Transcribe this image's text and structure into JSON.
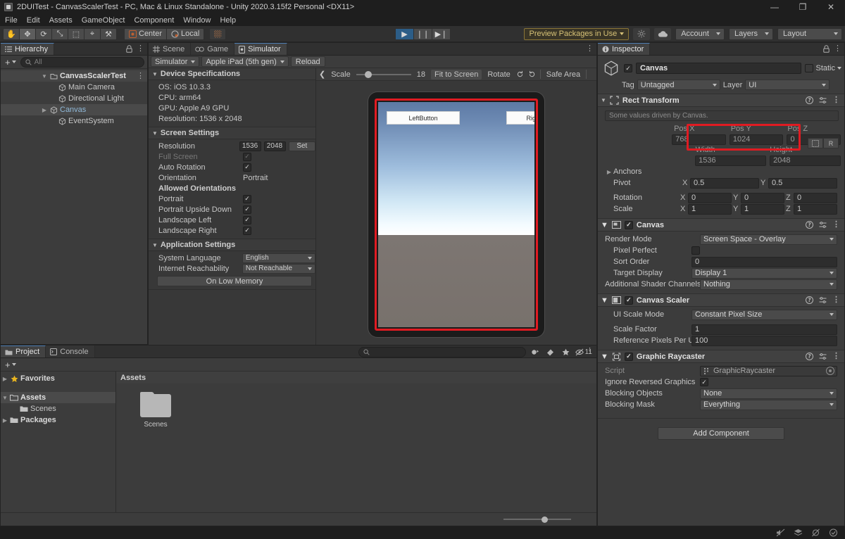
{
  "window": {
    "title": "2DUITest - CanvasScalerTest - PC, Mac & Linux Standalone - Unity 2020.3.15f2 Personal <DX11>",
    "app_icon": "unity-icon",
    "minimize": "—",
    "maximize": "❐",
    "close": "✕"
  },
  "menubar": {
    "items": [
      "File",
      "Edit",
      "Assets",
      "GameObject",
      "Component",
      "Window",
      "Help"
    ]
  },
  "toolbar": {
    "tools": [
      {
        "name": "hand-tool",
        "glyph": "✋"
      },
      {
        "name": "move-tool",
        "glyph": "✥"
      },
      {
        "name": "rotate-tool",
        "glyph": "⟳"
      },
      {
        "name": "scale-tool",
        "glyph": "⤡"
      },
      {
        "name": "rect-tool",
        "glyph": "⬚"
      },
      {
        "name": "transform-tool",
        "glyph": "⌖"
      },
      {
        "name": "custom-tool",
        "glyph": "⚒"
      }
    ],
    "pivot_label": "Center",
    "pivot_icon": "pivot-center-icon",
    "space_label": "Local",
    "space_icon": "handle-local-icon",
    "grid_icon": "grid-snapping-icon",
    "play_label": "▶",
    "pause_label": "❘❘",
    "step_label": "▶❘",
    "preview_packages": "Preview Packages in Use",
    "collab_icon": "collab-icon",
    "cloud_icon": "cloud-icon",
    "account_label": "Account",
    "layers_label": "Layers",
    "layout_label": "Layout"
  },
  "hierarchy": {
    "tab_label": "Hierarchy",
    "tab_icon": "hierarchy-icon",
    "lock_icon": "lock-icon",
    "menu_icon": "kebab-icon",
    "add_label": "+",
    "search_placeholder": "All",
    "search_icon": "search-icon",
    "items": [
      {
        "label": "CanvasScalerTest",
        "depth": 0,
        "icon": "scene-icon",
        "expanded": true,
        "style": "root",
        "has_menu": true
      },
      {
        "label": "Main Camera",
        "depth": 1,
        "icon": "gameobject-icon",
        "expanded": null,
        "style": "normal",
        "has_menu": false
      },
      {
        "label": "Directional Light",
        "depth": 1,
        "icon": "gameobject-icon",
        "expanded": null,
        "style": "normal",
        "has_menu": false
      },
      {
        "label": "Canvas",
        "depth": 1,
        "icon": "gameobject-icon",
        "expanded": false,
        "style": "selected",
        "has_menu": false
      },
      {
        "label": "EventSystem",
        "depth": 1,
        "icon": "gameobject-icon",
        "expanded": null,
        "style": "normal",
        "has_menu": false
      }
    ]
  },
  "simulator": {
    "tabs": [
      {
        "label": "Scene",
        "icon": "scene-tab-icon",
        "active": false
      },
      {
        "label": "Game",
        "icon": "game-tab-icon",
        "active": false
      },
      {
        "label": "Simulator",
        "icon": "simulator-tab-icon",
        "active": true
      }
    ],
    "menu_icon": "kebab-icon",
    "mode_label": "Simulator",
    "device_label": "Apple iPad (5th gen)",
    "reload_label": "Reload",
    "device_specs": {
      "section_title": "Device Specifications",
      "lines": [
        "OS: iOS 10.3.3",
        "CPU: arm64",
        "GPU: Apple A9 GPU",
        "Resolution: 1536 x 2048"
      ]
    },
    "screen_settings": {
      "section_title": "Screen Settings",
      "resolution_label": "Resolution",
      "resolution_width": "1536",
      "resolution_height": "2048",
      "set_label": "Set",
      "full_screen_label": "Full Screen",
      "full_screen_checked": true,
      "auto_rotation_label": "Auto Rotation",
      "auto_rotation_checked": true,
      "orientation_label": "Orientation",
      "orientation_value": "Portrait",
      "allowed_orientations_label": "Allowed Orientations",
      "allowed": [
        {
          "label": "Portrait",
          "checked": true
        },
        {
          "label": "Portrait Upside Down",
          "checked": true
        },
        {
          "label": "Landscape Left",
          "checked": true
        },
        {
          "label": "Landscape Right",
          "checked": true
        }
      ]
    },
    "application_settings": {
      "section_title": "Application Settings",
      "system_language_label": "System Language",
      "system_language_value": "English",
      "internet_reachability_label": "Internet Reachability",
      "internet_reachability_value": "Not Reachable",
      "on_low_memory_label": "On Low Memory"
    },
    "view_toolbar": {
      "back_icon": "chevron-left-icon",
      "scale_label": "Scale",
      "scale_value": "18",
      "fit_label": "Fit to Screen",
      "rotate_label": "Rotate",
      "rotate_ccw_icon": "rotate-ccw-icon",
      "rotate_cw_icon": "rotate-cw-icon",
      "safe_area_label": "Safe Area"
    },
    "device_screen": {
      "left_button_label": "LeftButton",
      "right_button_label": "RightButton",
      "highlight_color": "#e01b22"
    }
  },
  "project": {
    "tabs": [
      {
        "label": "Project",
        "icon": "project-icon",
        "active": true
      },
      {
        "label": "Console",
        "icon": "console-icon",
        "active": false
      }
    ],
    "menu_icon": "kebab-icon",
    "add_label": "+",
    "search_placeholder": "",
    "search_icon": "search-icon",
    "filter_icons": [
      "object-filter-icon",
      "label-filter-icon",
      "favorite-filter-icon",
      "hidden-packages-icon"
    ],
    "hidden_packages_count": "11",
    "tree": [
      {
        "label": "Favorites",
        "depth": 0,
        "icon": "star-icon",
        "expanded": false,
        "style": "bold"
      },
      {
        "label": "Assets",
        "depth": 0,
        "icon": "folder-open-icon",
        "expanded": true,
        "style": "selected-bold"
      },
      {
        "label": "Scenes",
        "depth": 1,
        "icon": "folder-icon",
        "expanded": null,
        "style": "normal"
      },
      {
        "label": "Packages",
        "depth": 0,
        "icon": "folder-icon",
        "expanded": false,
        "style": "bold"
      }
    ],
    "content_header": "Assets",
    "assets": [
      {
        "label": "Scenes",
        "icon": "folder-icon"
      }
    ]
  },
  "inspector": {
    "tab_label": "Inspector",
    "tab_icon": "inspector-icon",
    "lock_icon": "lock-icon",
    "menu_icon": "kebab-icon",
    "object": {
      "enabled": true,
      "name": "Canvas",
      "icon": "gameobject-icon",
      "static_label": "Static",
      "static_checked": false,
      "tag_label": "Tag",
      "tag_value": "Untagged",
      "layer_label": "Layer",
      "layer_value": "UI"
    },
    "rect_transform": {
      "title": "Rect Transform",
      "icon": "rect-transform-icon",
      "help_icon": "help-icon",
      "preset_icon": "preset-icon",
      "menu_icon": "kebab-icon",
      "driven_note": "Some values driven by Canvas.",
      "pos_headers": [
        "Pos X",
        "Pos Y",
        "Pos Z"
      ],
      "pos_values": [
        "768",
        "1024",
        "0"
      ],
      "size_headers": [
        "Width",
        "Height"
      ],
      "size_values": [
        "1536",
        "2048"
      ],
      "anchors_label": "Anchors",
      "pivot_label": "Pivot",
      "pivot_values": [
        "0.5",
        "0.5"
      ],
      "rotation_label": "Rotation",
      "rotation_values": [
        "0",
        "0",
        "0"
      ],
      "scale_label": "Scale",
      "scale_values": [
        "1",
        "1",
        "1"
      ],
      "blueprint_icon": "blueprint-mode-icon",
      "raw_label": "R",
      "highlight_color": "#e01b22"
    },
    "canvas": {
      "title": "Canvas",
      "icon": "canvas-icon",
      "enabled": true,
      "help_icon": "help-icon",
      "preset_icon": "preset-icon",
      "menu_icon": "kebab-icon",
      "render_mode_label": "Render Mode",
      "render_mode_value": "Screen Space - Overlay",
      "pixel_perfect_label": "Pixel Perfect",
      "pixel_perfect_checked": false,
      "sort_order_label": "Sort Order",
      "sort_order_value": "0",
      "target_display_label": "Target Display",
      "target_display_value": "Display 1",
      "shader_channels_label": "Additional Shader Channels",
      "shader_channels_value": "Nothing"
    },
    "canvas_scaler": {
      "title": "Canvas Scaler",
      "icon": "canvas-scaler-icon",
      "enabled": true,
      "help_icon": "help-icon",
      "preset_icon": "preset-icon",
      "menu_icon": "kebab-icon",
      "ui_scale_mode_label": "UI Scale Mode",
      "ui_scale_mode_value": "Constant Pixel Size",
      "scale_factor_label": "Scale Factor",
      "scale_factor_value": "1",
      "reference_ppu_label": "Reference Pixels Per Unit",
      "reference_ppu_value": "100"
    },
    "graphic_raycaster": {
      "title": "Graphic Raycaster",
      "icon": "graphic-raycaster-icon",
      "enabled": true,
      "help_icon": "help-icon",
      "preset_icon": "preset-icon",
      "menu_icon": "kebab-icon",
      "script_label": "Script",
      "script_value": "GraphicRaycaster",
      "ignore_reversed_label": "Ignore Reversed Graphics",
      "ignore_reversed_checked": true,
      "blocking_objects_label": "Blocking Objects",
      "blocking_objects_value": "None",
      "blocking_mask_label": "Blocking Mask",
      "blocking_mask_value": "Everything"
    },
    "add_component_label": "Add Component"
  },
  "statusbar": {
    "icons": [
      "mute-audio-icon",
      "layers-status-icon",
      "gizmos-status-icon",
      "check-status-icon"
    ]
  }
}
